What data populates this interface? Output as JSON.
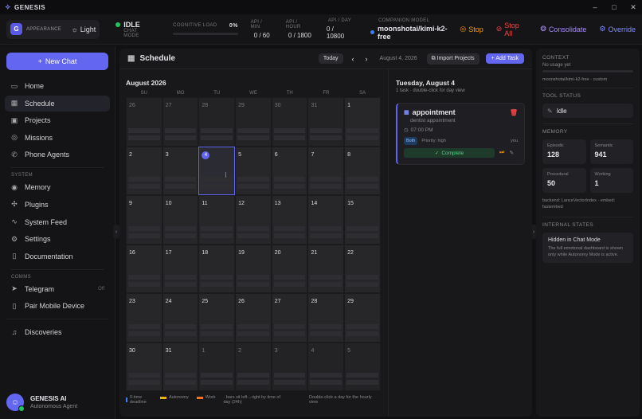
{
  "window": {
    "title": "GENESIS",
    "controls": [
      "minimize",
      "maximize",
      "close"
    ]
  },
  "topbar": {
    "avatar_letter": "G",
    "appearance_label": "APPEARANCE",
    "appearance_mode": "Light",
    "status": "IDLE",
    "status_sub": "CHAT MODE",
    "cognitive_load_label": "COGNITIVE LOAD",
    "cognitive_load_value": "0%",
    "cognitive_load_level": 0,
    "api_min_label": "API / MIN",
    "api_min_value": "0 / 60",
    "api_hour_label": "API / HOUR",
    "api_hour_value": "0 / 1800",
    "api_day_label": "API / DAY",
    "api_day_value": "0 / 10800",
    "companion_label": "COMPANION MODEL",
    "companion_value": "moonshotai/kimi-k2-free",
    "actions": {
      "stop": "Stop",
      "stop_all": "Stop All",
      "consolidate": "Consolidate",
      "override": "Override"
    },
    "colors": {
      "stop": "#f59e0b",
      "stop_all": "#ef4444",
      "consolidate": "#a78bfa",
      "override": "#818cf8"
    }
  },
  "sidebar": {
    "new_chat": "New Chat",
    "items": [
      {
        "label": "Home",
        "icon": "chat-icon"
      },
      {
        "label": "Schedule",
        "icon": "calendar-icon",
        "active": true
      },
      {
        "label": "Projects",
        "icon": "folder-icon"
      },
      {
        "label": "Missions",
        "icon": "target-icon"
      },
      {
        "label": "Phone Agents",
        "icon": "phone-icon"
      }
    ],
    "system_label": "SYSTEM",
    "system_items": [
      {
        "label": "Memory",
        "icon": "database-icon"
      },
      {
        "label": "Plugins",
        "icon": "puzzle-icon"
      },
      {
        "label": "System Feed",
        "icon": "activity-icon"
      },
      {
        "label": "Settings",
        "icon": "gear-icon"
      },
      {
        "label": "Documentation",
        "icon": "book-icon"
      }
    ],
    "comms_label": "COMMS",
    "comms_items": [
      {
        "label": "Telegram",
        "icon": "send-icon",
        "badge": "Off"
      },
      {
        "label": "Pair Mobile Device",
        "icon": "mobile-icon"
      }
    ],
    "other_items": [
      {
        "label": "Discoveries",
        "icon": "bell-icon"
      }
    ],
    "profile": {
      "name": "GENESIS AI",
      "role": "Autonomous Agent"
    }
  },
  "schedule": {
    "title": "Schedule",
    "today_btn": "Today",
    "current_date": "August 4, 2026",
    "import_btn": "Import Projects",
    "add_btn": "Add Task",
    "month": "August 2026",
    "weekdays": [
      "SU",
      "MO",
      "TU",
      "WE",
      "TH",
      "FR",
      "SA"
    ],
    "days": [
      "26",
      "27",
      "28",
      "29",
      "30",
      "31",
      "1",
      "2",
      "3",
      "4",
      "5",
      "6",
      "7",
      "8",
      "9",
      "10",
      "11",
      "12",
      "13",
      "14",
      "15",
      "16",
      "17",
      "18",
      "19",
      "20",
      "21",
      "22",
      "23",
      "24",
      "25",
      "26",
      "27",
      "28",
      "29",
      "30",
      "31",
      "1",
      "2",
      "3",
      "4",
      "5"
    ],
    "legend": {
      "deadline": "0-time deadline",
      "autonomy": "Autonomy",
      "work": "Work",
      "bars_note": "· bars sit left→right by time of day (24h)",
      "hint": "Double-click a day for the hourly view"
    },
    "legend_colors": {
      "deadline": "#3b82f6",
      "autonomy": "#eab308",
      "work": "#f97316"
    }
  },
  "day_panel": {
    "date": "Tuesday, August 4",
    "sub": "1 task · double-click for day view",
    "task": {
      "title": "appointment",
      "description": "dentist appointment",
      "time": "07:00 PM",
      "chip": "Both",
      "priority": "Priority: high",
      "assignee": "you",
      "complete_btn": "Complete"
    }
  },
  "right": {
    "context_label": "CONTEXT",
    "context_usage": "No usage yet",
    "context_model": "moonshotai/kimi-k2-free · custom",
    "tool_status_label": "TOOL STATUS",
    "tool_status": "Idle",
    "memory_label": "MEMORY",
    "memory": [
      {
        "k": "Episodic",
        "v": "128"
      },
      {
        "k": "Semantic",
        "v": "941"
      },
      {
        "k": "Procedural",
        "v": "50"
      },
      {
        "k": "Working",
        "v": "1"
      }
    ],
    "backend": "backend: LanceVectorIndex · embed: fastembed",
    "internal_label": "INTERNAL STATES",
    "internal_title": "Hidden in Chat Mode",
    "internal_desc": "The full emotional dashboard is shown only while Autonomy Mode is active."
  }
}
